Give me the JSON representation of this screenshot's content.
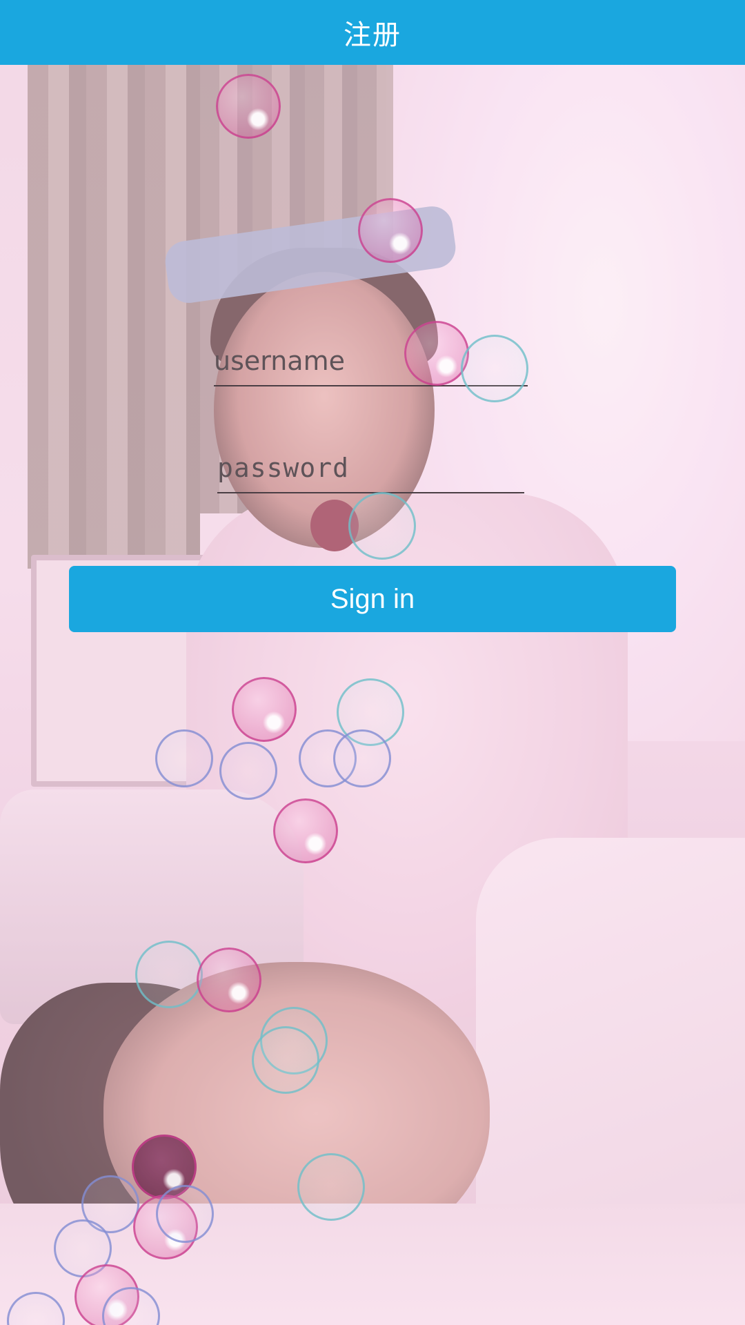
{
  "header": {
    "title": "注册"
  },
  "form": {
    "username_placeholder": "username",
    "password_placeholder": "password",
    "signin_label": "Sign in"
  },
  "colors": {
    "accent": "#1aa7df",
    "on_accent": "#ffffff"
  }
}
